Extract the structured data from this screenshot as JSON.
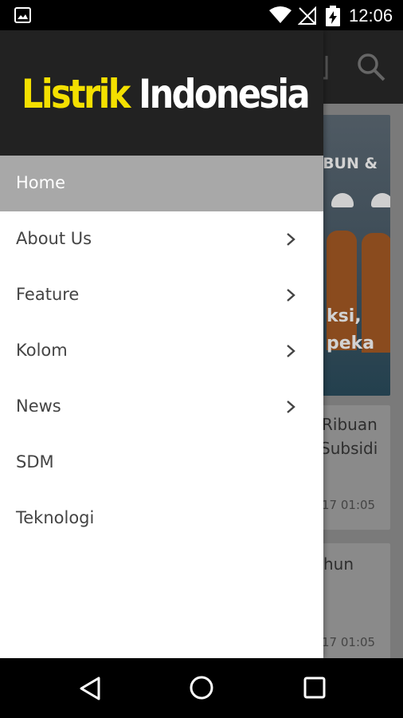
{
  "status_bar": {
    "time": "12:06",
    "icons": [
      "image-notification-icon",
      "wifi-icon",
      "no-signal-icon",
      "battery-charging-icon"
    ]
  },
  "app": {
    "brand": {
      "part1": "Listrik",
      "part2": "Indonesia"
    },
    "background": {
      "toolbar_icons": [
        "other-icon",
        "search-icon"
      ],
      "cards": [
        {
          "caption_line1": "IBUN &",
          "caption_line2": "ksi,",
          "caption_line3": "peka"
        },
        {
          "title_line1": "Ribuan",
          "title_line2": "Subsidi",
          "date": "17 01:05"
        },
        {
          "title_line1": "hun",
          "date": "17 01:05"
        }
      ]
    }
  },
  "drawer": {
    "menu": [
      {
        "label": "Home",
        "active": true,
        "has_submenu": false
      },
      {
        "label": "About Us",
        "active": false,
        "has_submenu": true
      },
      {
        "label": "Feature",
        "active": false,
        "has_submenu": true
      },
      {
        "label": "Kolom",
        "active": false,
        "has_submenu": true
      },
      {
        "label": "News",
        "active": false,
        "has_submenu": true
      },
      {
        "label": "SDM",
        "active": false,
        "has_submenu": false
      },
      {
        "label": "Teknologi",
        "active": false,
        "has_submenu": false
      }
    ]
  },
  "nav_bar": {
    "buttons": [
      "back-icon",
      "home-icon",
      "recent-apps-icon"
    ]
  },
  "colors": {
    "header_bg": "#222222",
    "logo_yellow": "#f4e000",
    "active_item_bg": "#a8a8a8",
    "item_text": "#444444"
  }
}
